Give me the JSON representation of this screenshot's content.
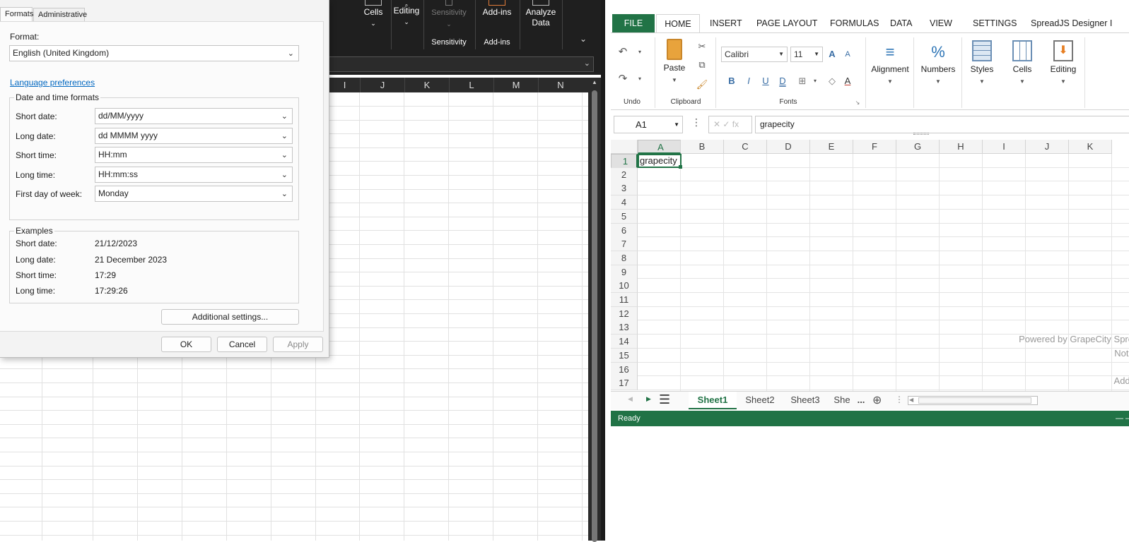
{
  "dialog": {
    "tabs": [
      "Formats",
      "Administrative"
    ],
    "format_label": "Format:",
    "format_value": "English (United Kingdom)",
    "language_link": "Language preferences",
    "dt_group_title": "Date and time formats",
    "fields": [
      {
        "label": "Short date:",
        "value": "dd/MM/yyyy"
      },
      {
        "label": "Long date:",
        "value": "dd MMMM yyyy"
      },
      {
        "label": "Short time:",
        "value": "HH:mm"
      },
      {
        "label": "Long time:",
        "value": "HH:mm:ss"
      },
      {
        "label": "First day of week:",
        "value": "Monday"
      }
    ],
    "examples_title": "Examples",
    "examples": [
      {
        "label": "Short date:",
        "value": "21/12/2023"
      },
      {
        "label": "Long date:",
        "value": "21 December 2023"
      },
      {
        "label": "Short time:",
        "value": "17:29"
      },
      {
        "label": "Long time:",
        "value": "17:29:26"
      }
    ],
    "additional_button": "Additional settings...",
    "ok_button": "OK",
    "cancel_button": "Cancel",
    "apply_button": "Apply"
  },
  "bg_excel": {
    "ribbon": {
      "cells": "Cells",
      "editing": "Editing",
      "sensitivity_btn": "Sensitivity",
      "addins_btn": "Add-ins",
      "analyze_line1": "Analyze",
      "analyze_line2": "Data",
      "group_sensitivity": "Sensitivity",
      "group_addins": "Add-ins"
    },
    "columns": [
      "I",
      "J",
      "K",
      "L",
      "M",
      "N"
    ]
  },
  "spreadjs": {
    "tabs": [
      "FILE",
      "HOME",
      "INSERT",
      "PAGE LAYOUT",
      "FORMULAS",
      "DATA",
      "VIEW",
      "SETTINGS",
      "SpreadJS Designer I"
    ],
    "groups": {
      "undo": "Undo",
      "clipboard": "Clipboard",
      "fonts": "Fonts",
      "paste": "Paste",
      "alignment": "Alignment",
      "numbers": "Numbers",
      "styles": "Styles",
      "cells": "Cells",
      "editing": "Editing"
    },
    "font_name": "Calibri",
    "font_size": "11",
    "name_box": "A1",
    "formula": "grapecity",
    "fx_symbols": "✕ ✓ fx",
    "columns": [
      "A",
      "B",
      "C",
      "D",
      "E",
      "F",
      "G",
      "H",
      "I",
      "J",
      "K"
    ],
    "rows": [
      "1",
      "2",
      "3",
      "4",
      "5",
      "6",
      "7",
      "8",
      "9",
      "10",
      "11",
      "12",
      "13",
      "14",
      "15",
      "16",
      "17"
    ],
    "cell_a1": "grapecity",
    "watermark_line1": "Powered by GrapeCity Spre",
    "watermark_line2": "Not l",
    "watermark_line3": "Add-",
    "sheets": [
      "Sheet1",
      "Sheet2",
      "Sheet3",
      "She"
    ],
    "sheet_more": "...",
    "status": "Ready",
    "colors": {
      "accent": "#217346"
    }
  }
}
